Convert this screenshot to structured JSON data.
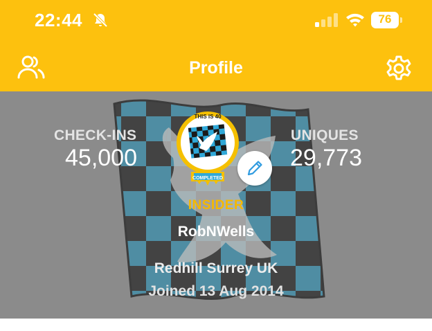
{
  "status_bar": {
    "time": "22:44",
    "battery": "76",
    "icons": [
      "bell-slash-icon",
      "signal-icon",
      "wifi-icon",
      "battery-icon"
    ]
  },
  "nav": {
    "title": "Profile",
    "left_icon": "friends-icon",
    "right_icon": "gear-icon"
  },
  "profile": {
    "checkins_label": "CHECK-INS",
    "checkins_value": "45,000",
    "uniques_label": "UNIQUES",
    "uniques_value": "29,773",
    "badge_top": "THIS IS 40",
    "badge_bottom": "COMPLETED",
    "level": "INSIDER",
    "username": "RobNWells",
    "location": "Redhill Surrey UK",
    "joined": "Joined 13 Aug 2014",
    "edit_icon": "pencil-icon"
  },
  "colors": {
    "brand_yellow": "#FDC10E",
    "header_gray": "#8B8B8B",
    "flag_blue": "#2F8FB0",
    "level_gold": "#F5B800"
  }
}
